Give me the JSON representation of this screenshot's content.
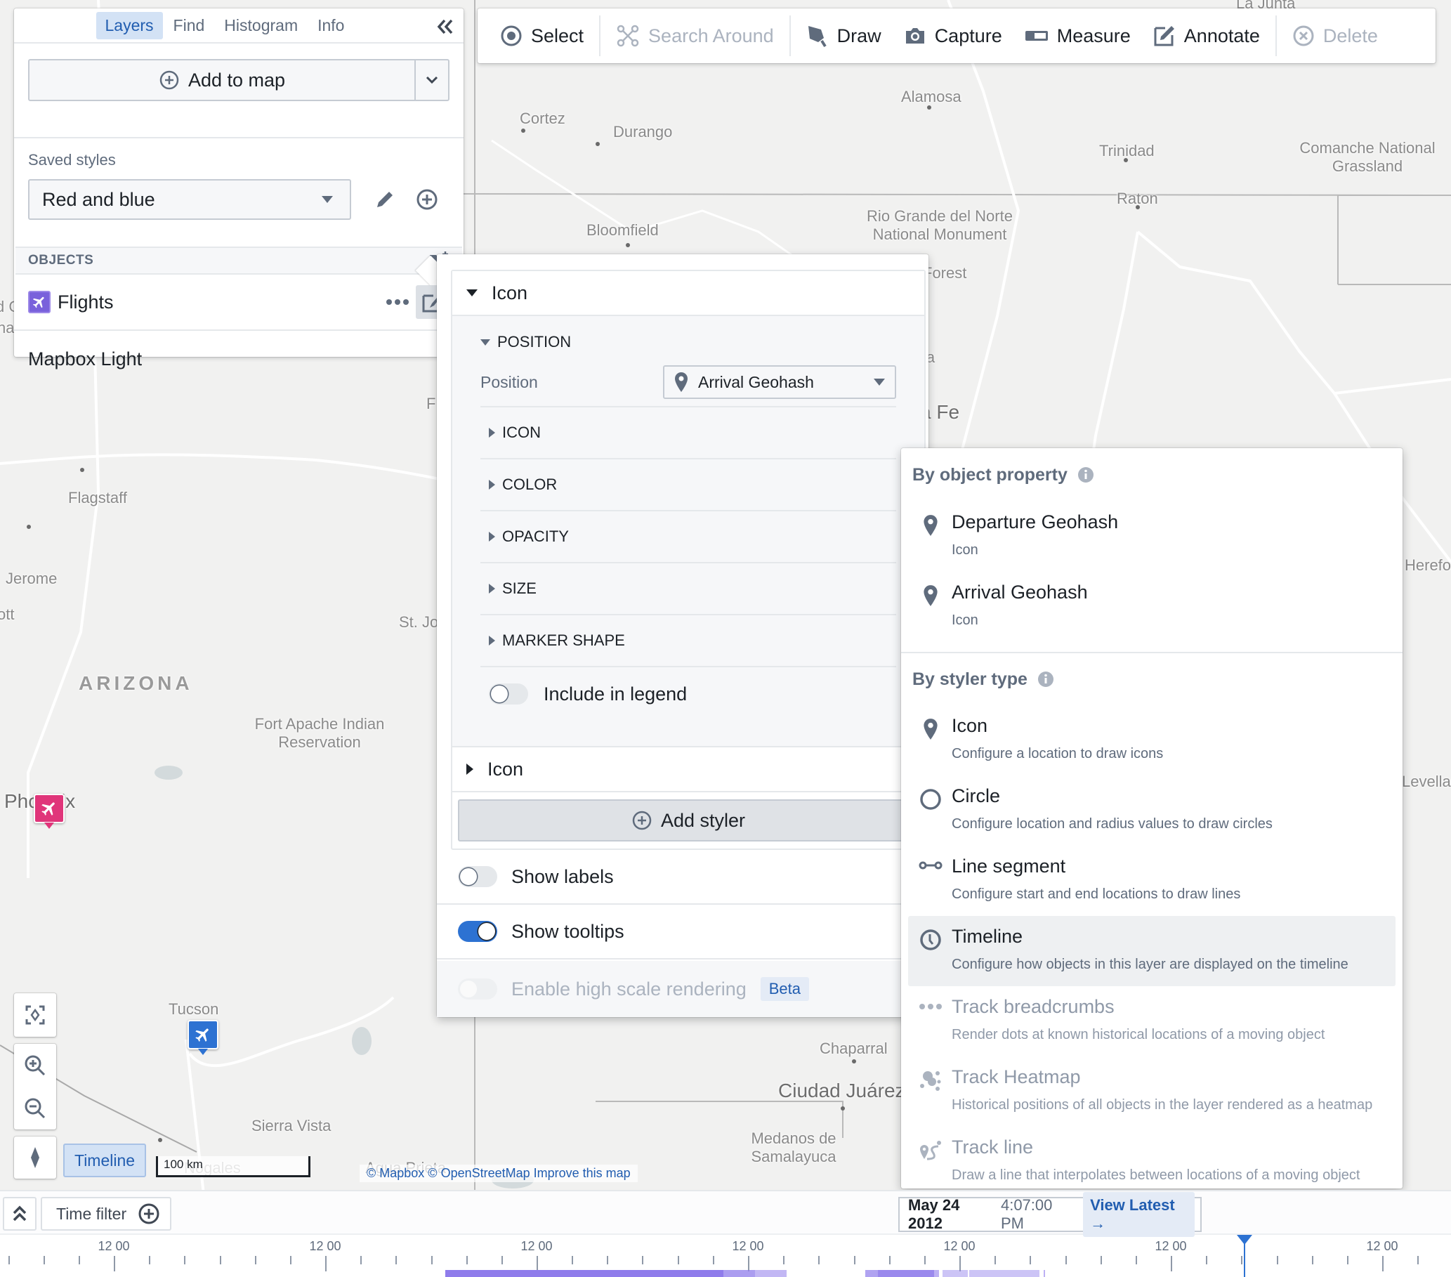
{
  "left_panel": {
    "tabs": [
      {
        "label": "Layers",
        "active": true
      },
      {
        "label": "Find",
        "active": false
      },
      {
        "label": "Histogram",
        "active": false
      },
      {
        "label": "Info",
        "active": false
      }
    ],
    "add_to_map_label": "Add to map",
    "saved_styles_label": "Saved styles",
    "saved_style_value": "Red and blue",
    "objects_header": "OBJECTS",
    "layers": [
      {
        "name": "Flights",
        "icon": "airplane-icon",
        "color": "#7961db"
      }
    ],
    "basemap_name": "Mapbox Light"
  },
  "toolbar": {
    "items": [
      {
        "label": "Select",
        "icon": "select-target-icon",
        "disabled": false
      },
      {
        "label": "Search Around",
        "icon": "graph-nodes-icon",
        "disabled": true
      },
      {
        "label": "Draw",
        "icon": "pen-draw-icon",
        "disabled": false
      },
      {
        "label": "Capture",
        "icon": "camera-icon",
        "disabled": false
      },
      {
        "label": "Measure",
        "icon": "ruler-icon",
        "disabled": false
      },
      {
        "label": "Annotate",
        "icon": "annotate-edit-icon",
        "disabled": false
      },
      {
        "label": "Delete",
        "icon": "delete-circle-x-icon",
        "disabled": true
      }
    ]
  },
  "style_popover": {
    "styler_title": "Icon",
    "position_section": "POSITION",
    "position_label": "Position",
    "position_value": "Arrival Geohash",
    "sections": [
      "ICON",
      "COLOR",
      "OPACITY",
      "SIZE",
      "MARKER SHAPE"
    ],
    "include_in_legend_label": "Include in legend",
    "include_in_legend": false,
    "second_styler_title": "Icon",
    "add_styler_label": "Add styler",
    "show_labels_label": "Show labels",
    "show_labels": false,
    "show_tooltips_label": "Show tooltips",
    "show_tooltips": true,
    "high_scale_label": "Enable high scale rendering",
    "high_scale": false,
    "beta_tag": "Beta"
  },
  "styler_menu": {
    "by_property_heading": "By object property",
    "property_items": [
      {
        "title": "Departure Geohash",
        "subtitle": "Icon",
        "icon": "map-pin-icon"
      },
      {
        "title": "Arrival Geohash",
        "subtitle": "Icon",
        "icon": "map-pin-icon"
      }
    ],
    "by_type_heading": "By styler type",
    "type_items": [
      {
        "title": "Icon",
        "subtitle": "Configure a location to draw icons",
        "icon": "map-pin-icon",
        "disabled": false,
        "active": false
      },
      {
        "title": "Circle",
        "subtitle": "Configure location and radius values to draw circles",
        "icon": "circle-icon",
        "disabled": false,
        "active": false
      },
      {
        "title": "Line segment",
        "subtitle": "Configure start and end locations to draw lines",
        "icon": "line-segment-icon",
        "disabled": false,
        "active": false
      },
      {
        "title": "Timeline",
        "subtitle": "Configure how objects in this layer are displayed on the timeline",
        "icon": "clock-icon",
        "disabled": false,
        "active": true
      },
      {
        "title": "Track breadcrumbs",
        "subtitle": "Render dots at known historical locations of a moving object",
        "icon": "dots-icon",
        "disabled": true,
        "active": false
      },
      {
        "title": "Track Heatmap",
        "subtitle": "Historical positions of all objects in the layer rendered as a heatmap",
        "icon": "heatmap-icon",
        "disabled": true,
        "active": false
      },
      {
        "title": "Track line",
        "subtitle": "Draw a line that interpolates between locations of a moving object",
        "icon": "track-line-icon",
        "disabled": true,
        "active": false
      }
    ]
  },
  "map": {
    "labels": [
      {
        "text": "La Junta"
      },
      {
        "text": "Cortez"
      },
      {
        "text": "Durango"
      },
      {
        "text": "Alamosa"
      },
      {
        "text": "Trinidad"
      },
      {
        "text": "Comanche National Grassland"
      },
      {
        "text": "Raton"
      },
      {
        "text": "Bloomfield"
      },
      {
        "text": "Rio Grande del Norte National Monument"
      },
      {
        "text": "Forest"
      },
      {
        "text": "la"
      },
      {
        "text": "a Fe"
      },
      {
        "text": "Flagstaff"
      },
      {
        "text": "Jerome"
      },
      {
        "text": "ott"
      },
      {
        "text": "St. Jo"
      },
      {
        "text": "ARIZONA"
      },
      {
        "text": "Fort Apache Indian Reservation"
      },
      {
        "text": "Phoenix"
      },
      {
        "text": "Tucson"
      },
      {
        "text": "Sierra Vista"
      },
      {
        "text": "Nogales"
      },
      {
        "text": "Agua Prieta"
      },
      {
        "text": "Chaparral"
      },
      {
        "text": "Ciudad Juárez"
      },
      {
        "text": "Medanos de Samalayuca"
      },
      {
        "text": "Herefor"
      },
      {
        "text": "Levellar"
      },
      {
        "text": "F"
      },
      {
        "text": "d C"
      },
      {
        "text": "na"
      }
    ],
    "markers": [
      {
        "name": "Phoenix flight",
        "color": "#e0357a"
      },
      {
        "name": "Tucson flight",
        "color": "#2d72d2"
      }
    ],
    "timeline_toggle_label": "Timeline",
    "scale_label": "100 km",
    "attribution": "© Mapbox © OpenStreetMap Improve this map"
  },
  "timeline": {
    "time_filter_label": "Time filter",
    "date": "May 24 2012",
    "time": "4:07:00 PM",
    "view_latest_label": "View Latest →",
    "axis_labels": [
      "12 00",
      "12 00",
      "12 00",
      "12 00",
      "12 00",
      "12 00",
      "12 00"
    ],
    "bar_color": "#8f7ceb"
  }
}
